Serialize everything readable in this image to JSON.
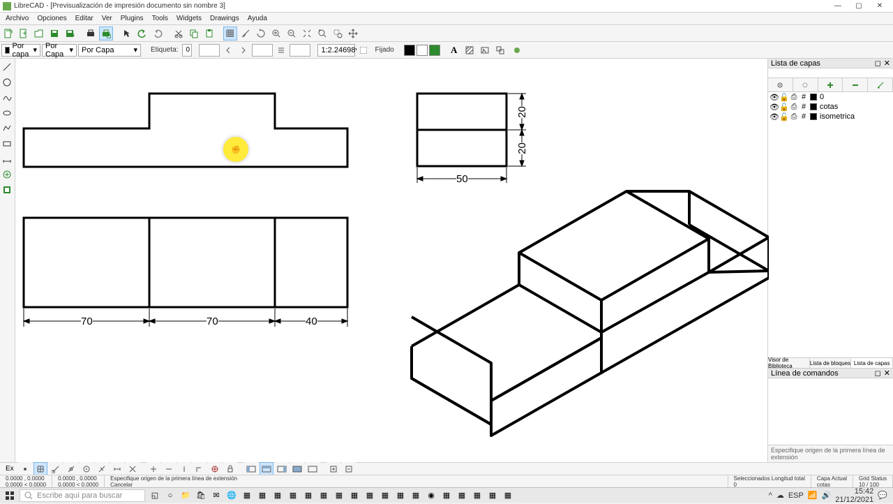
{
  "title": "LibreCAD - [Previsualización de impresión documento sin nombre 3]",
  "menus": [
    "Archivo",
    "Opciones",
    "Editar",
    "Ver",
    "Plugins",
    "Tools",
    "Widgets",
    "Drawings",
    "Ayuda"
  ],
  "toolbar2": {
    "layer_sel": "Por capa",
    "linetype_sel": "Por Capa",
    "lineweight_sel": "Por Capa",
    "etiqueta_lbl": "Etiqueta:",
    "etiqueta_val": "0",
    "scale_val": "1:2.24698",
    "fijado_lbl": "Fijado"
  },
  "layers_panel": {
    "title": "Lista de capas",
    "items": [
      {
        "name": "0"
      },
      {
        "name": "cotas"
      },
      {
        "name": "isometrica"
      }
    ]
  },
  "right_tabs": [
    "Visor de Biblioteca",
    "Lista de bloques",
    "Lista de capas"
  ],
  "cmd_title": "Línea de comandos",
  "cmd_hint": "Especifique origen de la primera línea de extensión",
  "dims": {
    "d70a": "70",
    "d70b": "70",
    "d40": "40",
    "d50": "50",
    "d20a": "20",
    "d20b": "20"
  },
  "status": {
    "ex": "Ex",
    "coord1": "0.0000 , 0.0000",
    "coord2": "0.0000 < 0.0000",
    "hint_label": "Especifique origen de la primera línea de extensión",
    "cancel": "Cancelar",
    "sel_label": "Seleccionados Longitud total",
    "sel_val": "0",
    "layer_label": "Capa Actual",
    "layer_val": "cotas",
    "grid_label": "Grid Status",
    "grid_val": "10 / 100"
  },
  "taskbar": {
    "search_placeholder": "Escribe aquí para buscar",
    "time": "15:42",
    "date": "21/12/2021",
    "lang": "ESP"
  },
  "highlight_glyph": "✊"
}
